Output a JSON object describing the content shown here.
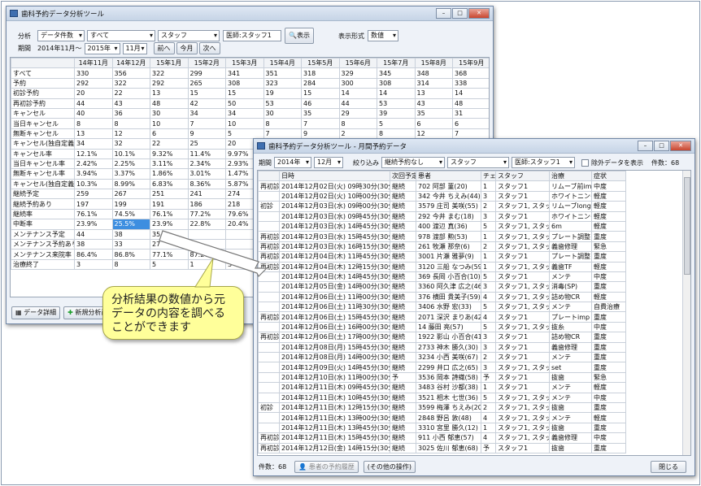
{
  "win1": {
    "title": "歯科予約データ分析ツール",
    "filter_label": "分析",
    "select_data_type": "データ件数",
    "select_all": "すべて",
    "select_staff": "スタッフ",
    "doctor_label": "医師:スタッフ1",
    "show_button": "表示",
    "display_format_label": "表示形式",
    "display_format_value": "数値",
    "period_label": "期間",
    "period_from": "2014年11月～",
    "period_year": "2015年",
    "period_month": "11月",
    "prev_button": "前へ",
    "this_month_button": "今月",
    "next_button": "次へ",
    "columns": [
      "14年11月",
      "14年12月",
      "15年1月",
      "15年2月",
      "15年3月",
      "15年4月",
      "15年5月",
      "15年6月",
      "15年7月",
      "15年8月",
      "15年9月"
    ],
    "rows": [
      {
        "label": "すべて",
        "values": [
          "330",
          "356",
          "322",
          "299",
          "341",
          "351",
          "318",
          "329",
          "345",
          "348",
          "368"
        ]
      },
      {
        "label": "予約",
        "values": [
          "292",
          "322",
          "292",
          "265",
          "308",
          "323",
          "284",
          "300",
          "308",
          "314",
          "338"
        ]
      },
      {
        "label": "初診予約",
        "values": [
          "20",
          "22",
          "13",
          "15",
          "15",
          "19",
          "15",
          "14",
          "14",
          "13",
          "14"
        ]
      },
      {
        "label": "再初診予約",
        "values": [
          "44",
          "43",
          "48",
          "42",
          "50",
          "53",
          "46",
          "44",
          "53",
          "43",
          "48"
        ]
      },
      {
        "label": "キャンセル",
        "values": [
          "40",
          "36",
          "30",
          "34",
          "34",
          "30",
          "35",
          "29",
          "39",
          "35",
          "31"
        ]
      },
      {
        "label": "当日キャンセル",
        "values": [
          "8",
          "8",
          "10",
          "7",
          "10",
          "8",
          "7",
          "8",
          "5",
          "6",
          "6"
        ]
      },
      {
        "label": "無断キャンセル",
        "values": [
          "13",
          "12",
          "6",
          "9",
          "5",
          "7",
          "9",
          "2",
          "8",
          "12",
          "7"
        ]
      },
      {
        "label": "キャンセル(独自定義)",
        "values": [
          "34",
          "32",
          "22",
          "25",
          "20",
          "",
          "",
          "",
          "",
          "",
          ""
        ]
      },
      {
        "label": "キャンセル率",
        "values": [
          "12.1%",
          "10.1%",
          "9.32%",
          "11.4%",
          "9.97%",
          "",
          "",
          "",
          "",
          "",
          ""
        ]
      },
      {
        "label": "当日キャンセル率",
        "values": [
          "2.42%",
          "2.25%",
          "3.11%",
          "2.34%",
          "2.93%",
          "",
          "",
          "",
          "",
          "",
          ""
        ]
      },
      {
        "label": "無断キャンセル率",
        "values": [
          "3.94%",
          "3.37%",
          "1.86%",
          "3.01%",
          "1.47%",
          "",
          "",
          "",
          "",
          "",
          ""
        ]
      },
      {
        "label": "キャンセル(独自定義)率",
        "values": [
          "10.3%",
          "8.99%",
          "6.83%",
          "8.36%",
          "5.87%",
          "",
          "",
          "",
          "",
          "",
          ""
        ]
      },
      {
        "label": "継続予定",
        "values": [
          "259",
          "267",
          "251",
          "241",
          "274",
          "",
          "",
          "",
          "",
          "",
          ""
        ]
      },
      {
        "label": "継続予約あり",
        "values": [
          "197",
          "199",
          "191",
          "186",
          "218",
          "",
          "",
          "",
          "",
          "",
          ""
        ]
      },
      {
        "label": "継続率",
        "values": [
          "76.1%",
          "74.5%",
          "76.1%",
          "77.2%",
          "79.6%",
          "",
          "",
          "",
          "",
          "",
          ""
        ]
      },
      {
        "label": "中断率",
        "values": [
          "23.9%",
          "25.5%",
          "23.9%",
          "22.8%",
          "20.4%",
          "",
          "",
          "",
          "",
          "",
          ""
        ]
      },
      {
        "label": "メンテナンス予定",
        "values": [
          "44",
          "38",
          "35",
          "",
          "",
          "",
          "",
          "",
          "",
          "",
          ""
        ]
      },
      {
        "label": "メンテナンス予約あり",
        "values": [
          "38",
          "33",
          "27",
          "34",
          "",
          "",
          "",
          "",
          "",
          "",
          ""
        ]
      },
      {
        "label": "メンテナンス来院率",
        "values": [
          "86.4%",
          "86.8%",
          "77.1%",
          "87.2%",
          "",
          "",
          "",
          "",
          "",
          "",
          ""
        ]
      },
      {
        "label": "治療終了",
        "values": [
          "3",
          "8",
          "5",
          "1",
          "3",
          "",
          "",
          "",
          "",
          "",
          ""
        ]
      }
    ],
    "data_detail_button": "データ詳細",
    "new_analysis_button": "新規分析画面"
  },
  "win2": {
    "title": "歯科予約データ分析ツール - 月間予約データ",
    "period_label": "期間",
    "year": "2014年",
    "month": "12月",
    "narrow_label": "絞り込み",
    "narrow_value": "継続予約なし",
    "staff_value": "スタッフ",
    "doctor_value": "医師:スタッフ1",
    "exclude_label": "除外データを表示",
    "count_top": "件数：68",
    "headers": [
      "",
      "日時",
      "次回予定",
      "患者",
      "チェア",
      "スタッフ",
      "治療",
      "症状"
    ],
    "rows": [
      [
        "再初診",
        "2014年12月02日(火) 09時30分(30分間)",
        "継続",
        "702 阿部 菫(20)",
        "1",
        "スタッフ1",
        "リムーブ前imp",
        "中度"
      ],
      [
        "",
        "2014年12月02日(火) 10時00分(30分間)",
        "継続",
        "342 今井 ちえみ(44)",
        "3",
        "スタッフ1",
        "ホワイトニング",
        "軽度"
      ],
      [
        "初診",
        "2014年12月03日(水) 09時00分(30分間)",
        "継続",
        "3579 庄司 美咲(55)",
        "2",
        "スタッフ1, スタッフ4",
        "リムーブlong",
        "軽度"
      ],
      [
        "",
        "2014年12月03日(水) 09時45分(30分間)",
        "継続",
        "292 今井 まむ(18)",
        "3",
        "スタッフ1",
        "ホワイトニング",
        "軽度"
      ],
      [
        "",
        "2014年12月03日(水) 14時45分(30分間)",
        "継続",
        "400 渡辺 真(36)",
        "5",
        "スタッフ1, スタッフ6",
        "6m",
        "軽度"
      ],
      [
        "再初診",
        "2014年12月03日(水) 15時45分(30分間)",
        "継続",
        "978 渡部 勲(53)",
        "1",
        "スタッフ1, スタッフ5",
        "プレート調整",
        "重度"
      ],
      [
        "再初診",
        "2014年12月03日(水) 16時15分(30分間)",
        "継続",
        "261 牧瀬 那奈(6)",
        "2",
        "スタッフ1, スタッフ5",
        "義歯修理",
        "緊急"
      ],
      [
        "再初診",
        "2014年12月04日(木) 11時45分(30分間)",
        "継続",
        "3001 片瀬 雅夢(9)",
        "1",
        "スタッフ1",
        "プレート調整",
        "重度"
      ],
      [
        "再初診",
        "2014年12月04日(木) 12時15分(30分間)",
        "継続",
        "3120 三船 なつみ(59)",
        "1",
        "スタッフ1, スタッフ8",
        "義歯TF",
        "軽度"
      ],
      [
        "",
        "2014年12月04日(木) 14時45分(30分間)",
        "継続",
        "369 長岡 小百合(10)",
        "5",
        "スタッフ1",
        "メンテ",
        "中度"
      ],
      [
        "",
        "2014年12月05日(金) 14時00分(30分間)",
        "継続",
        "3360 阿久津 広之(46)",
        "3",
        "スタッフ1, スタッフ7",
        "消毒(SP)",
        "重度"
      ],
      [
        "",
        "2014年12月06日(土) 11時00分(30分間)",
        "継続",
        "376 横田 貴美子(59)",
        "4",
        "スタッフ1, スタッフ4",
        "詰め物CR",
        "軽度"
      ],
      [
        "",
        "2014年12月06日(土) 11時30分(30分間)",
        "継続",
        "3406 水野 宏(33)",
        "5",
        "スタッフ1, スタッフ7",
        "メンテ",
        "自費治療"
      ],
      [
        "再初診",
        "2014年12月06日(土) 15時45分(30分間)",
        "継続",
        "2071 深沢 まりあ(42)",
        "4",
        "スタッフ1",
        "プレートimp",
        "重度"
      ],
      [
        "",
        "2014年12月06日(土) 16時00分(30分間)",
        "継続",
        "14 藤田 亮(57)",
        "5",
        "スタッフ1, スタッフ5",
        "抜糸",
        "中度"
      ],
      [
        "再初診",
        "2014年12月06日(土) 17時00分(30分間)",
        "継続",
        "1922 影山 小百合(41)",
        "3",
        "スタッフ1",
        "詰め物CR",
        "重度"
      ],
      [
        "",
        "2014年12月08日(月) 15時45分(30分間)",
        "継続",
        "2733 神木 勝久(30)",
        "3",
        "スタッフ1",
        "義歯修理",
        "重度"
      ],
      [
        "",
        "2014年12月08日(月) 14時00分(30分間)",
        "継続",
        "3234 小西 美咲(67)",
        "2",
        "スタッフ1",
        "メンテ",
        "重度"
      ],
      [
        "",
        "2014年12月09日(火) 14時45分(30分間)",
        "継続",
        "2299 井口 広之(65)",
        "3",
        "スタッフ1, スタッフ9",
        "set",
        "重度"
      ],
      [
        "",
        "2014年12月10日(水) 11時00分(30分間)",
        "予",
        "3536 岡本 詩織(58)",
        "予",
        "スタッフ1",
        "抜歯",
        "緊急"
      ],
      [
        "",
        "2014年12月11日(木) 09時45分(30分間)",
        "継続",
        "3483 谷村 沙都(38)",
        "1",
        "スタッフ1",
        "メンテ",
        "軽度"
      ],
      [
        "",
        "2014年12月11日(木) 10時45分(30分間)",
        "継続",
        "3521 相木 七世(36)",
        "5",
        "スタッフ1, スタッフ7",
        "メンテ",
        "中度"
      ],
      [
        "初診",
        "2014年12月11日(木) 12時15分(30分間)",
        "継続",
        "3599 梅澤 ちえみ(20)",
        "2",
        "スタッフ1, スタッフ6",
        "抜歯",
        "重度"
      ],
      [
        "",
        "2014年12月11日(木) 13時00分(30分間)",
        "継続",
        "2848 野呂 敦(48)",
        "4",
        "スタッフ1, スタッフ9",
        "メンテ",
        "軽度"
      ],
      [
        "",
        "2014年12月11日(木) 13時45分(30分間)",
        "継続",
        "3310 宮里 勝久(12)",
        "1",
        "スタッフ1, スタッフ9",
        "抜歯",
        "重度"
      ],
      [
        "再初診",
        "2014年12月11日(木) 15時45分(30分間)",
        "継続",
        "911 小西 郁恵(57)",
        "4",
        "スタッフ1, スタッフ5",
        "義歯修理",
        "中度"
      ],
      [
        "再初診",
        "2014年12月12日(金) 14時15分(30分間)",
        "継続",
        "3025 佐川 郁恵(68)",
        "予",
        "スタッフ1",
        "抜歯",
        "重度"
      ]
    ],
    "count_bottom": "件数：68",
    "patient_history_button": "患者の予約履歴",
    "other_ops_button": "(その他の操作)",
    "close_button": "閉じる"
  },
  "callout_text": "分析結果の数値から元データの内容を調べることができます"
}
